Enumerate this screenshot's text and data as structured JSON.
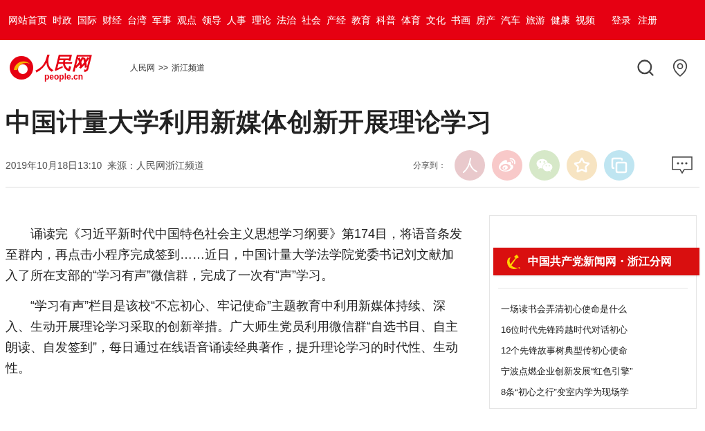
{
  "top_nav": {
    "items": [
      "网站首页",
      "时政",
      "国际",
      "财经",
      "台湾",
      "军事",
      "观点",
      "领导",
      "人事",
      "理论",
      "法治",
      "社会",
      "产经",
      "教育",
      "科普",
      "体育",
      "文化",
      "书画",
      "房产",
      "汽车",
      "旅游",
      "健康",
      "视频"
    ],
    "account": [
      "登录",
      "注册"
    ]
  },
  "header": {
    "logo_text": "人民网",
    "logo_domain": "people.cn",
    "breadcrumb": [
      "人民网",
      ">>",
      "浙江频道"
    ]
  },
  "article": {
    "title": "中国计量大学利用新媒体创新开展理论学习",
    "date": "2019年10月18日13:10",
    "source": "来源：人民网浙江频道",
    "share_label": "分享到：",
    "share_buttons": [
      {
        "kind": "people",
        "color": "#e9c9cc"
      },
      {
        "kind": "weibo",
        "color": "#f8c9c9"
      },
      {
        "kind": "wechat",
        "color": "#d6e8c8"
      },
      {
        "kind": "qzone",
        "color": "#f7e4c2"
      },
      {
        "kind": "copy",
        "color": "#bfe5f1"
      }
    ],
    "paragraphs": [
      "诵读完《习近平新时代中国特色社会主义思想学习纲要》第174目，将语音条发至群内，再点击小程序完成签到……近日，中国计量大学法学院党委书记刘文献加入了所在支部的“学习有声”微信群，完成了一次有“声”学习。",
      "“学习有声”栏目是该校“不忘初心、牢记使命”主题教育中利用新媒体持续、深入、生动开展理论学习采取的创新举措。广大师生党员利用微信群“自选书目、自主朗读、自发签到”，每日通过在线语音诵读经典著作，提升理论学习的时代性、生动性。"
    ]
  },
  "sidebar": {
    "banner_text": "中国共产党新闻网・浙江分网",
    "links": [
      "一场读书会弄清初心使命是什么",
      "16位时代先锋跨越时代对话初心",
      "12个先锋故事树典型传初心使命",
      "宁波点燃企业创新发展“红色引擎”",
      "8条“初心之行”变室内学为现场学"
    ]
  }
}
